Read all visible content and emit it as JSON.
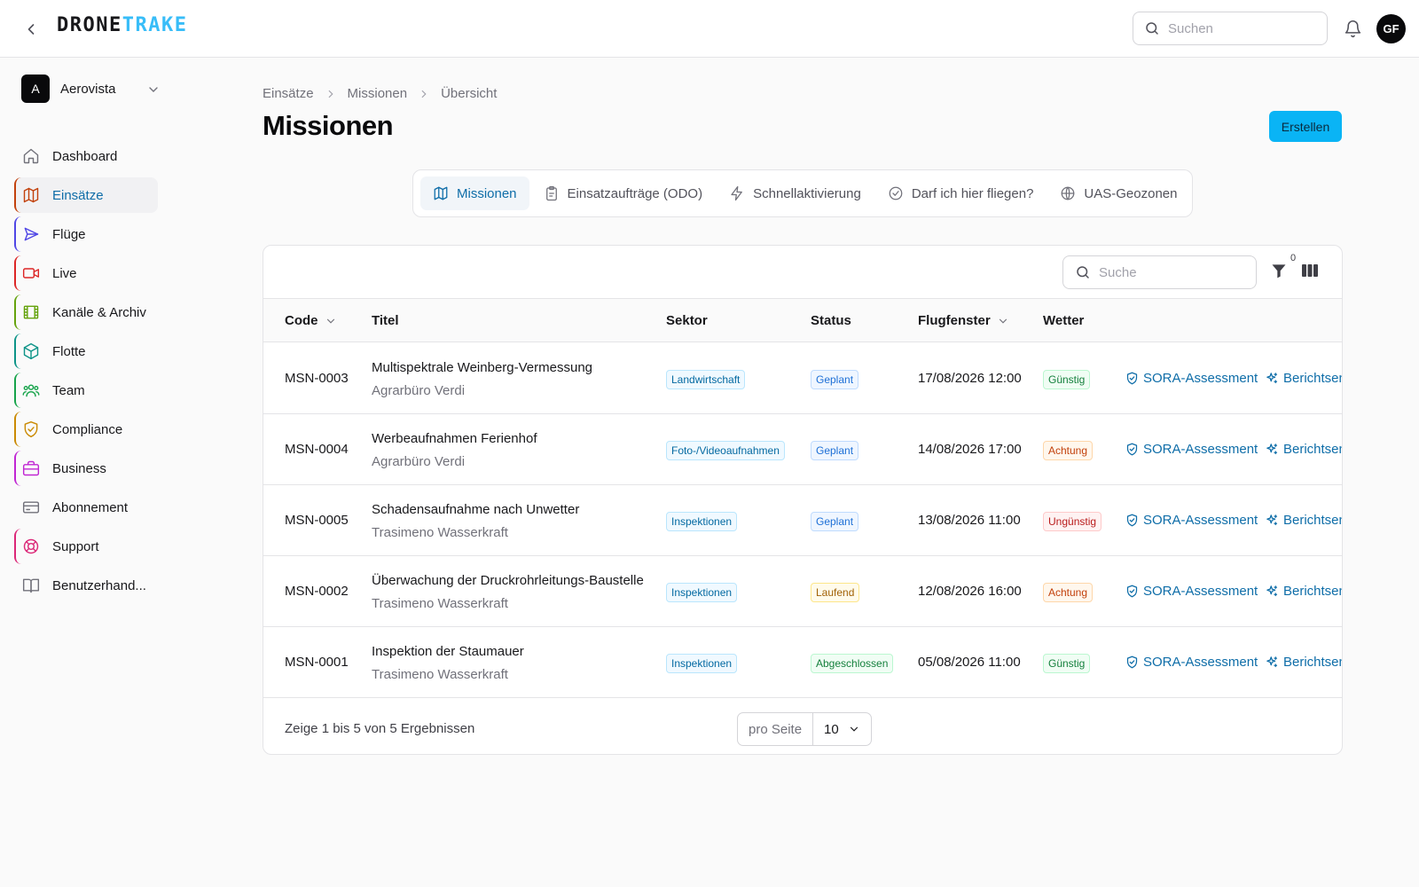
{
  "app": {
    "logo_part1": "DRONE",
    "logo_part2": "TRAKE"
  },
  "header": {
    "search_placeholder": "Suchen",
    "user_initials": "GF"
  },
  "org": {
    "initial": "A",
    "name": "Aerovista"
  },
  "sidebar": {
    "items": [
      {
        "label": "Dashboard",
        "icon": "home-icon",
        "accent": ""
      },
      {
        "label": "Einsätze",
        "icon": "map-icon",
        "accent": "#c2410c",
        "active": true
      },
      {
        "label": "Flüge",
        "icon": "send-icon",
        "accent": "#4f46e5"
      },
      {
        "label": "Live",
        "icon": "video-icon",
        "accent": "#dc2626"
      },
      {
        "label": "Kanäle & Archiv",
        "icon": "film-icon",
        "accent": "#65a30d"
      },
      {
        "label": "Flotte",
        "icon": "box-icon",
        "accent": "#0d9488"
      },
      {
        "label": "Team",
        "icon": "users-icon",
        "accent": "#16a34a"
      },
      {
        "label": "Compliance",
        "icon": "shield-icon",
        "accent": "#ca8a04"
      },
      {
        "label": "Business",
        "icon": "briefcase-icon",
        "accent": "#c026d3"
      },
      {
        "label": "Abonnement",
        "icon": "credit-card-icon",
        "accent": ""
      },
      {
        "label": "Support",
        "icon": "lifebuoy-icon",
        "accent": "#db2777"
      },
      {
        "label": "Benutzerhand...",
        "icon": "book-icon",
        "accent": ""
      }
    ]
  },
  "breadcrumb": [
    "Einsätze",
    "Missionen",
    "Übersicht"
  ],
  "page": {
    "title": "Missionen",
    "create_label": "Erstellen"
  },
  "tabs": [
    {
      "label": "Missionen",
      "icon": "map-icon",
      "active": true
    },
    {
      "label": "Einsatzaufträge (ODO)",
      "icon": "clipboard-icon"
    },
    {
      "label": "Schnellaktivierung",
      "icon": "zap-icon"
    },
    {
      "label": "Darf ich hier fliegen?",
      "icon": "check-circle-icon"
    },
    {
      "label": "UAS-Geozonen",
      "icon": "globe-icon"
    }
  ],
  "table": {
    "search_placeholder": "Suche",
    "filter_count": "0",
    "columns": {
      "code": "Code",
      "title": "Titel",
      "sector": "Sektor",
      "status": "Status",
      "window": "Flugfenster",
      "weather": "Wetter"
    },
    "rows": [
      {
        "code": "MSN-0003",
        "title": "Multispektrale Weinberg-Vermessung",
        "client": "Agrarbüro Verdi",
        "sector": "Landwirtschaft",
        "status": "Geplant",
        "window": "17/08/2026 12:00",
        "weather": "Günstig",
        "action1": "SORA-Assessment",
        "action2": "Berichtsentwurf"
      },
      {
        "code": "MSN-0004",
        "title": "Werbeaufnahmen Ferienhof",
        "client": "Agrarbüro Verdi",
        "sector": "Foto-/Videoaufnahmen",
        "status": "Geplant",
        "window": "14/08/2026 17:00",
        "weather": "Achtung",
        "action1": "SORA-Assessment",
        "action2": "Berichtsentwurf"
      },
      {
        "code": "MSN-0005",
        "title": "Schadensaufnahme nach Unwetter",
        "client": "Trasimeno Wasserkraft",
        "sector": "Inspektionen",
        "status": "Geplant",
        "window": "13/08/2026 11:00",
        "weather": "Ungünstig",
        "action1": "SORA-Assessment",
        "action2": "Berichtsentwurf"
      },
      {
        "code": "MSN-0002",
        "title": "Überwachung der Druckrohrleitungs-Baustelle",
        "client": "Trasimeno Wasserkraft",
        "sector": "Inspektionen",
        "status": "Laufend",
        "window": "12/08/2026 16:00",
        "weather": "Achtung",
        "action1": "SORA-Assessment",
        "action2": "Berichtsentwurf"
      },
      {
        "code": "MSN-0001",
        "title": "Inspektion der Staumauer",
        "client": "Trasimeno Wasserkraft",
        "sector": "Inspektionen",
        "status": "Abgeschlossen",
        "window": "05/08/2026 11:00",
        "weather": "Günstig",
        "action1": "SORA-Assessment",
        "action2": "Berichtsentwurf"
      }
    ],
    "footer_text": "Zeige 1 bis 5 von 5 Ergebnissen",
    "per_page_label": "pro Seite",
    "per_page_value": "10"
  }
}
